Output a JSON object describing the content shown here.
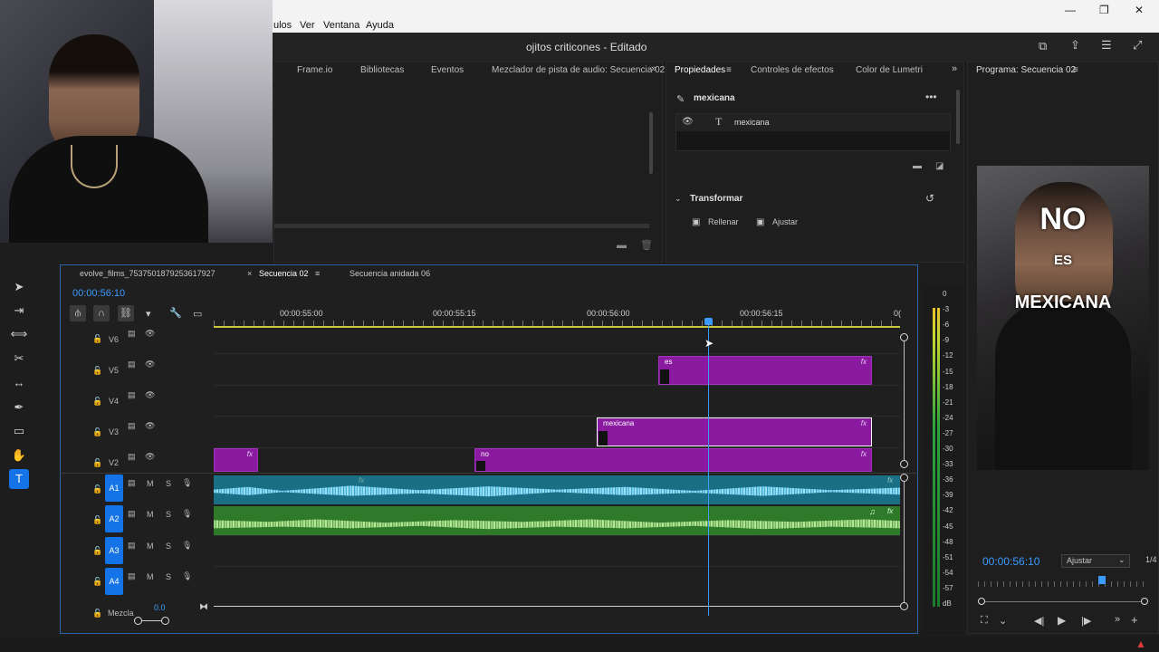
{
  "menu": {
    "items": [
      "ulos",
      "Ver",
      "Ventana",
      "Ayuda"
    ]
  },
  "titlebar": {
    "title": "ojitos criticones - Editado"
  },
  "top_panel": {
    "tabs": [
      "Frame.io",
      "Bibliotecas",
      "Eventos",
      "Mezclador de pista de audio: Secuencia 02"
    ]
  },
  "properties": {
    "tabs": [
      "Propiedades",
      "Controles de efectos",
      "Color de Lumetri"
    ],
    "clip_name": "mexicana",
    "layer_name": "mexicana",
    "section": "Transformar",
    "fill_label": "Rellenar",
    "fit_label": "Ajustar"
  },
  "program": {
    "title": "Programa: Secuencia 02",
    "overlay_lines": [
      "NO",
      "ES",
      "MEXICANA"
    ],
    "timecode": "00:00:56:10",
    "fit_option": "Ajustar",
    "ratio": "1/4"
  },
  "timeline": {
    "tabs": [
      "evolve_films_7537501879253617927",
      "Secuencia 02",
      "Secuencia anidada 06"
    ],
    "timecode": "00:00:56:10",
    "ruler": [
      "00:00:55:00",
      "00:00:55:15",
      "00:00:56:00",
      "00:00:56:15",
      "0("
    ],
    "video_tracks": [
      "V6",
      "V5",
      "V4",
      "V3",
      "V2"
    ],
    "audio_tracks": [
      "A1",
      "A2",
      "A3",
      "A4"
    ],
    "mix_label": "Mezcla",
    "mix_value": "0.0",
    "clips": {
      "es": "es",
      "mexicana": "mexicana",
      "no": "no",
      "fx": "fx"
    },
    "m": "M",
    "s": "S"
  },
  "meter": {
    "labels": [
      "0",
      "-3",
      "-6",
      "-9",
      "-12",
      "-15",
      "-18",
      "-21",
      "-24",
      "-27",
      "-30",
      "-33",
      "-36",
      "-39",
      "-42",
      "-45",
      "-48",
      "-51",
      "-54",
      "-57",
      "dB"
    ]
  }
}
